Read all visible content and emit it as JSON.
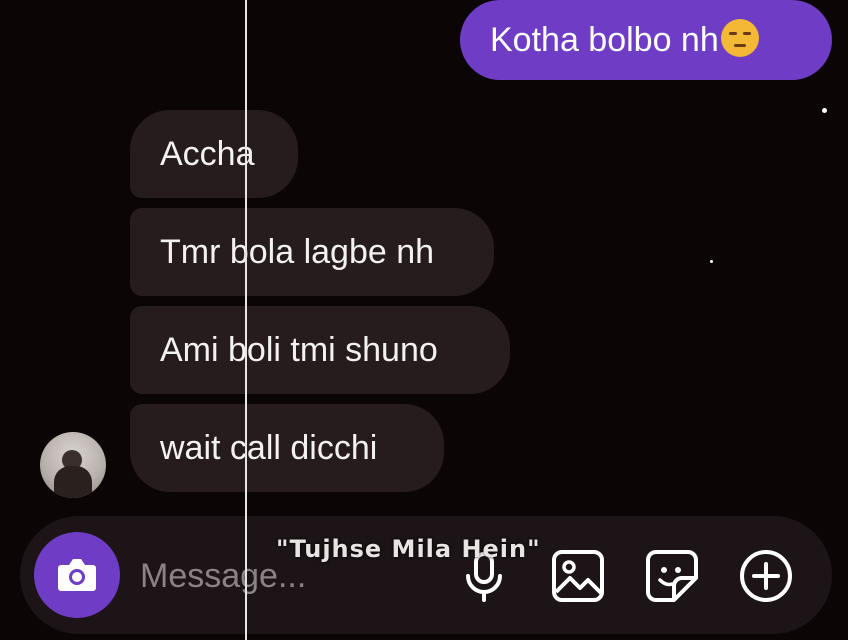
{
  "chat": {
    "outgoing": [
      {
        "text": "Kotha bolbo nh",
        "emoji": "unamused-face-emoji"
      }
    ],
    "incoming": [
      {
        "text": "Accha"
      },
      {
        "text": "Tmr bola lagbe nh"
      },
      {
        "text": "Ami boli tmi shuno"
      },
      {
        "text": "wait call dicchi"
      }
    ]
  },
  "composer": {
    "placeholder": "Message...",
    "value": "",
    "icons": [
      "camera-icon",
      "microphone-icon",
      "image-icon",
      "sticker-icon",
      "plus-icon"
    ]
  },
  "overlay": {
    "caption": "\"Tujhse Mila Hein\""
  },
  "colors": {
    "background": "#0b0506",
    "outgoing_bubble": "#6f3cc6",
    "incoming_bubble": "#261c1e",
    "composer": "#1c1416",
    "accent": "#6f3cc6"
  }
}
